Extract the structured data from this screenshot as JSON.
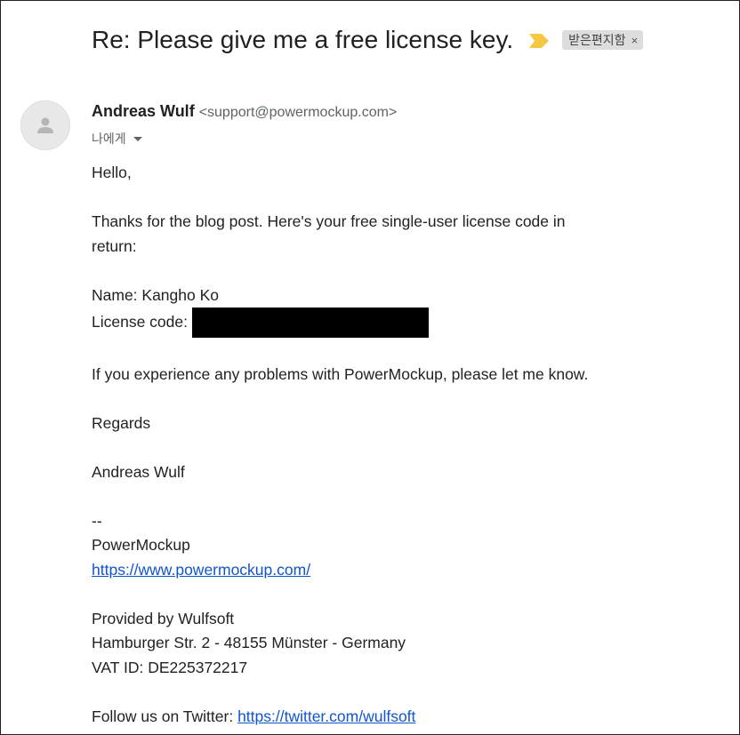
{
  "header": {
    "subject": "Re: Please give me a free license key.",
    "label": "받은편지함",
    "label_close": "×",
    "importance_icon": "importance-marker-icon",
    "importance_color": "#f4c842"
  },
  "sender": {
    "name": "Andreas Wulf",
    "email": "<support@powermockup.com>",
    "to": "나에게",
    "avatar_icon": "person-icon"
  },
  "body": {
    "greeting": "Hello,",
    "intro_line1": "Thanks for the blog post. Here's your free single-user license code in",
    "intro_line2": "return:",
    "name_line": "Name: Kangho Ko",
    "license_label": "License code:",
    "problems_line": "If you experience any problems with PowerMockup, please let me know.",
    "regards": "Regards",
    "signoff": "Andreas Wulf",
    "sig_dash": "--",
    "company": "PowerMockup",
    "company_url": "https://www.powermockup.com/",
    "provided_by": "Provided by Wulfsoft",
    "address": "Hamburger Str. 2 - 48155 Münster - Germany",
    "vat": "VAT ID: DE225372217",
    "follow_label": "Follow us on Twitter:",
    "twitter_url": "https://twitter.com/wulfsoft"
  },
  "colors": {
    "link": "#1155cc",
    "redaction": "#000000"
  }
}
